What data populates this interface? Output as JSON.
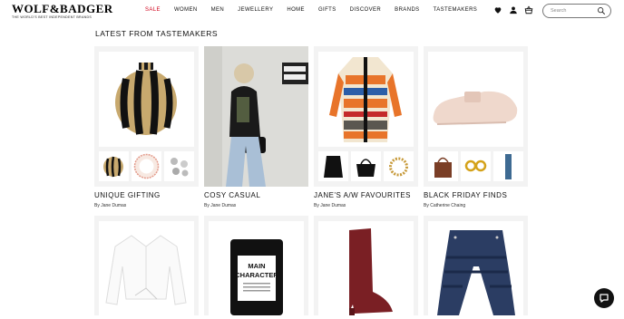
{
  "brand": {
    "name": "WOLF&BADGER",
    "tagline": "THE WORLD'S BEST INDEPENDENT BRANDS"
  },
  "nav": {
    "items": [
      {
        "label": "SALE",
        "sale": true
      },
      {
        "label": "WOMEN"
      },
      {
        "label": "MEN"
      },
      {
        "label": "JEWELLERY"
      },
      {
        "label": "HOME"
      },
      {
        "label": "GIFTS"
      },
      {
        "label": "DISCOVER"
      },
      {
        "label": "BRANDS"
      },
      {
        "label": "TASTEMAKERS"
      }
    ]
  },
  "header_icons": [
    "heart-icon",
    "user-icon",
    "basket-icon"
  ],
  "search": {
    "placeholder": "Search"
  },
  "section": {
    "title": "LATEST FROM TASTEMAKERS"
  },
  "cards": [
    {
      "title": "UNIQUE GIFTING",
      "byline": "By Jane Dumas"
    },
    {
      "title": "COSY CASUAL",
      "byline": "By Jane Dumas"
    },
    {
      "title": "JANE'S A/W FAVOURITES",
      "byline": "By Jane Dumas"
    },
    {
      "title": "BLACK FRIDAY FINDS",
      "byline": "By Catherine Chaing"
    }
  ],
  "colors": {
    "sale": "#d0021b",
    "chat": "#111111"
  }
}
